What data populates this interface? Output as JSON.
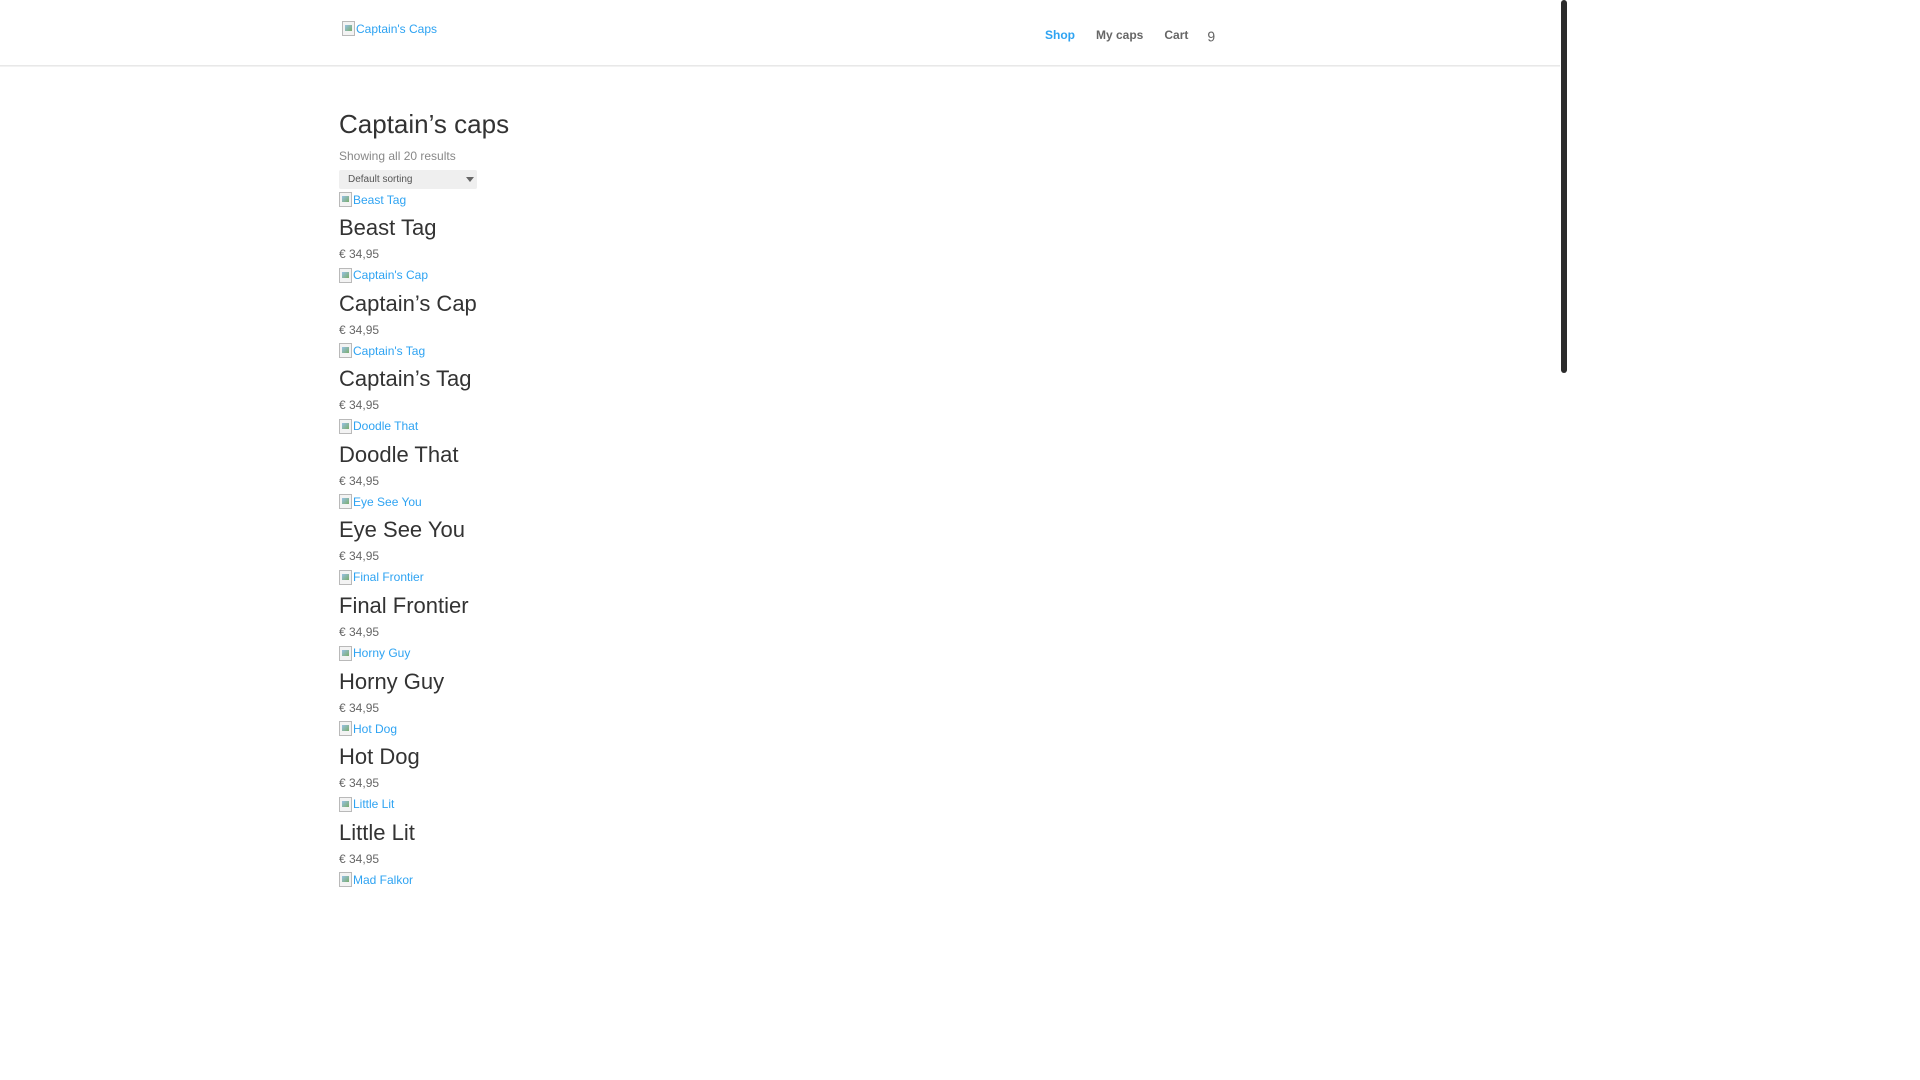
{
  "header": {
    "logo_alt": "Captain's Caps",
    "nav": [
      {
        "label": "Shop",
        "active": true
      },
      {
        "label": "My caps",
        "active": false
      },
      {
        "label": "Cart",
        "active": false
      }
    ],
    "search_icon": "search-icon"
  },
  "main": {
    "title": "Captain’s caps",
    "result_count": "Showing all 20 results",
    "ordering_selected": "Default sorting"
  },
  "products": [
    {
      "image_alt": "Beast Tag",
      "name": "Beast Tag",
      "price": "€ 34,95"
    },
    {
      "image_alt": "Captain's Cap",
      "name": "Captain’s Cap",
      "price": "€ 34,95"
    },
    {
      "image_alt": "Captain's Tag",
      "name": "Captain’s Tag",
      "price": "€ 34,95"
    },
    {
      "image_alt": "Doodle That",
      "name": "Doodle That",
      "price": "€ 34,95"
    },
    {
      "image_alt": "Eye See You",
      "name": "Eye See You",
      "price": "€ 34,95"
    },
    {
      "image_alt": "Final Frontier",
      "name": "Final Frontier",
      "price": "€ 34,95"
    },
    {
      "image_alt": "Horny Guy",
      "name": "Horny Guy",
      "price": "€ 34,95"
    },
    {
      "image_alt": "Hot Dog",
      "name": "Hot Dog",
      "price": "€ 34,95"
    },
    {
      "image_alt": "Little Lit",
      "name": "Little Lit",
      "price": "€ 34,95"
    },
    {
      "image_alt": "Mad Falkor",
      "name": "",
      "price": ""
    }
  ],
  "colors": {
    "accent": "#2ea3f2",
    "heading": "#333333",
    "text": "#666666"
  }
}
